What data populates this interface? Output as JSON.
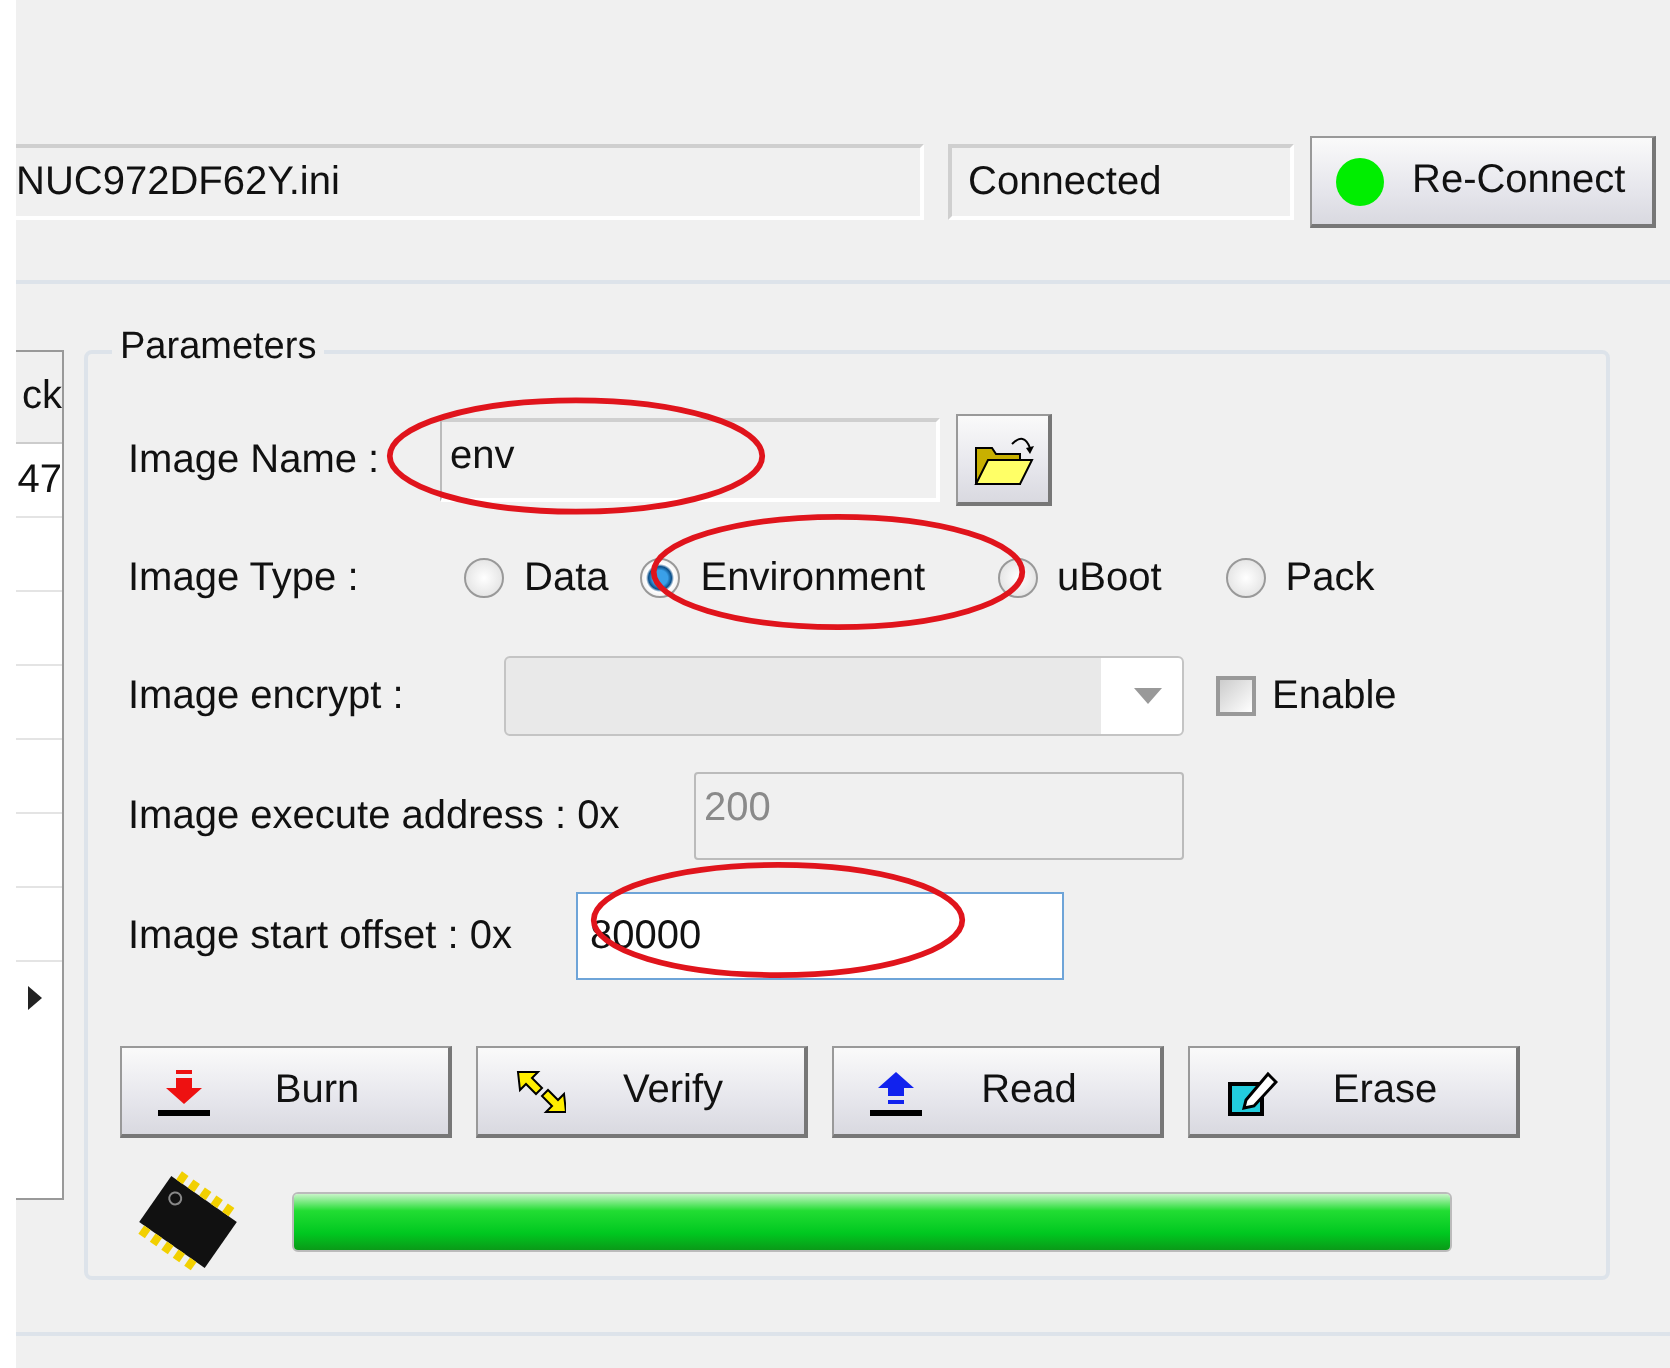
{
  "top_bar": {
    "file_path": "NUC972DF62Y.ini",
    "status": "Connected",
    "reconnect": {
      "label": "Re-Connect",
      "connected": true
    }
  },
  "side_list": {
    "header": "ck",
    "rows": [
      "47"
    ]
  },
  "parameters": {
    "title": "Parameters",
    "image_name": {
      "label": "Image Name :",
      "value": "env",
      "circled": true
    },
    "image_type": {
      "label": "Image Type :",
      "circled": true,
      "options": [
        {
          "label": "Data",
          "selected": false
        },
        {
          "label": "Environment",
          "selected": true
        },
        {
          "label": "uBoot",
          "selected": false
        },
        {
          "label": "Pack",
          "selected": false
        }
      ]
    },
    "image_encrypt": {
      "label": "Image encrypt :",
      "disabled": true,
      "enable": {
        "label": "Enable",
        "checked": false
      }
    },
    "execute_address": {
      "label": "Image execute address : 0x",
      "value": "200",
      "disabled": true
    },
    "start_offset": {
      "label": "Image start offset : 0x",
      "value": "80000",
      "focused": true,
      "circled": true
    },
    "actions": [
      {
        "label": "Burn",
        "kind": "burn"
      },
      {
        "label": "Verify",
        "kind": "verify"
      },
      {
        "label": "Read",
        "kind": "read"
      },
      {
        "label": "Erase",
        "kind": "erase"
      }
    ],
    "progress": {
      "level": 1
    }
  }
}
